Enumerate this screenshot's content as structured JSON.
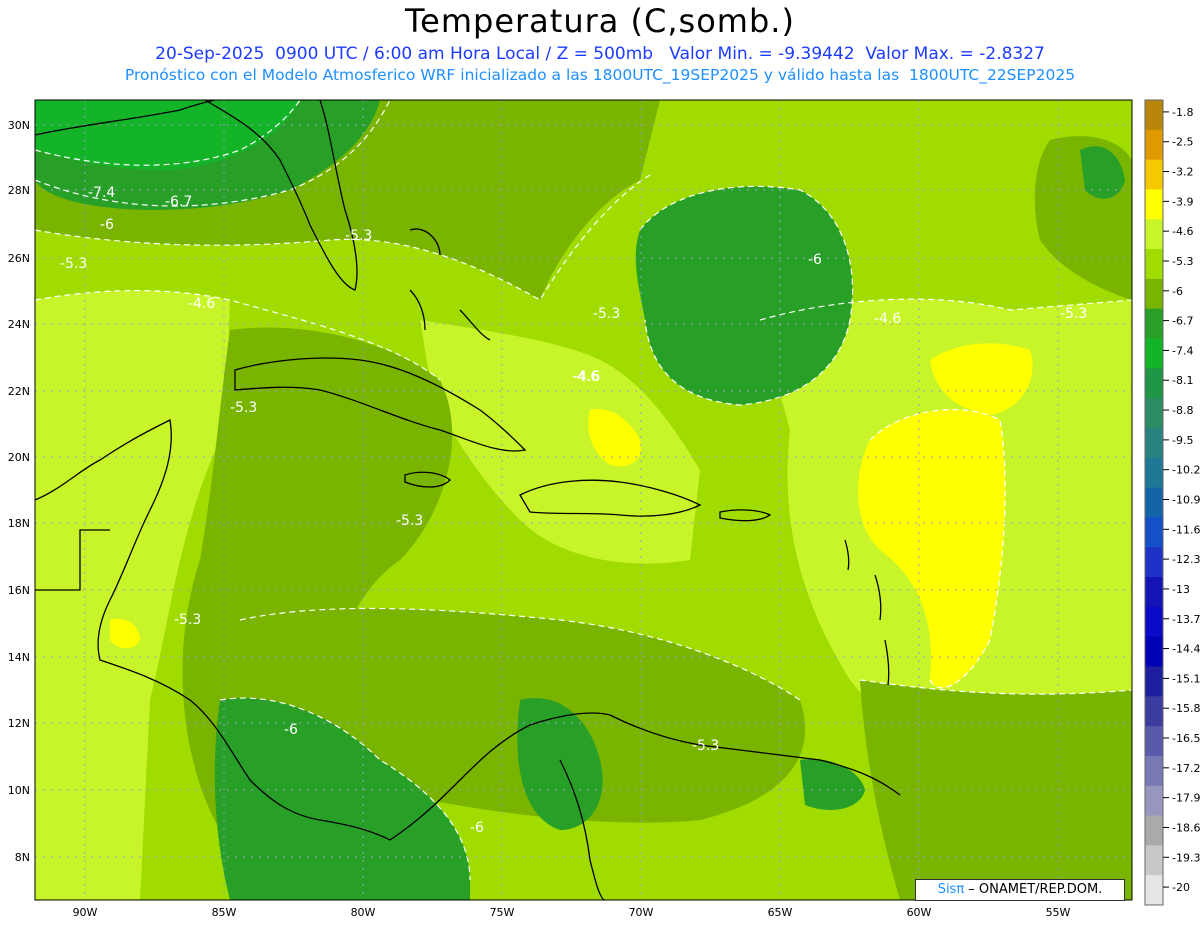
{
  "title": "Temperatura (C,somb.)",
  "subtitle_1": "20-Sep-2025  0900 UTC / 6:00 am Hora Local / Z = 500mb   Valor Min. = -9.39442  Valor Max. = -2.8327",
  "subtitle_2": "Pronóstico con el Modelo Atmosferico WRF inicializado a las 1800UTC_19SEP2025 y válido hasta las  1800UTC_22SEP2025",
  "lat_ticks": [
    "30N",
    "28N",
    "26N",
    "24N",
    "22N",
    "20N",
    "18N",
    "16N",
    "14N",
    "12N",
    "10N",
    "8N"
  ],
  "lon_ticks": [
    "90W",
    "85W",
    "80W",
    "75W",
    "70W",
    "65W",
    "60W",
    "55W"
  ],
  "colorbar": {
    "labels": [
      "-1.8",
      "-2.5",
      "-3.2",
      "-3.9",
      "-4.6",
      "-5.3",
      "-6",
      "-6.7",
      "-7.4",
      "-8.1",
      "-8.8",
      "-9.5",
      "-10.2",
      "-10.9",
      "-11.6",
      "-12.3",
      "-13",
      "-13.7",
      "-14.4",
      "-15.1",
      "-15.8",
      "-16.5",
      "-17.2",
      "-17.9",
      "-18.6",
      "-19.3",
      "-20"
    ],
    "colors": [
      "#b8860b",
      "#e09a00",
      "#f5c800",
      "#ffff00",
      "#c8f52a",
      "#a0dc00",
      "#78b400",
      "#28a028",
      "#14b428",
      "#1e9646",
      "#2d8c64",
      "#28827d",
      "#1e7896",
      "#1464aa",
      "#1450c8",
      "#1e32c8",
      "#1414b4",
      "#0a0ac8",
      "#0000b4",
      "#1e1ea0",
      "#3c3ca0",
      "#5a5aaa",
      "#7878b4",
      "#9696be",
      "#aaaaaa",
      "#c8c8c8",
      "#e6e6e6"
    ]
  },
  "contour_labels": [
    "-7.4",
    "-6.7",
    "-6",
    "-5.3",
    "-5.3",
    "-4.6",
    "-5.3",
    "-4.6",
    "-6",
    "-5.3",
    "-4.6",
    "-5.3",
    "-4.6",
    "-5.3",
    "-5.3",
    "-6",
    "-5.3",
    "-6"
  ],
  "credit": {
    "sistema": "Sisπ",
    "org": " – ONAMET/REP.DOM."
  }
}
